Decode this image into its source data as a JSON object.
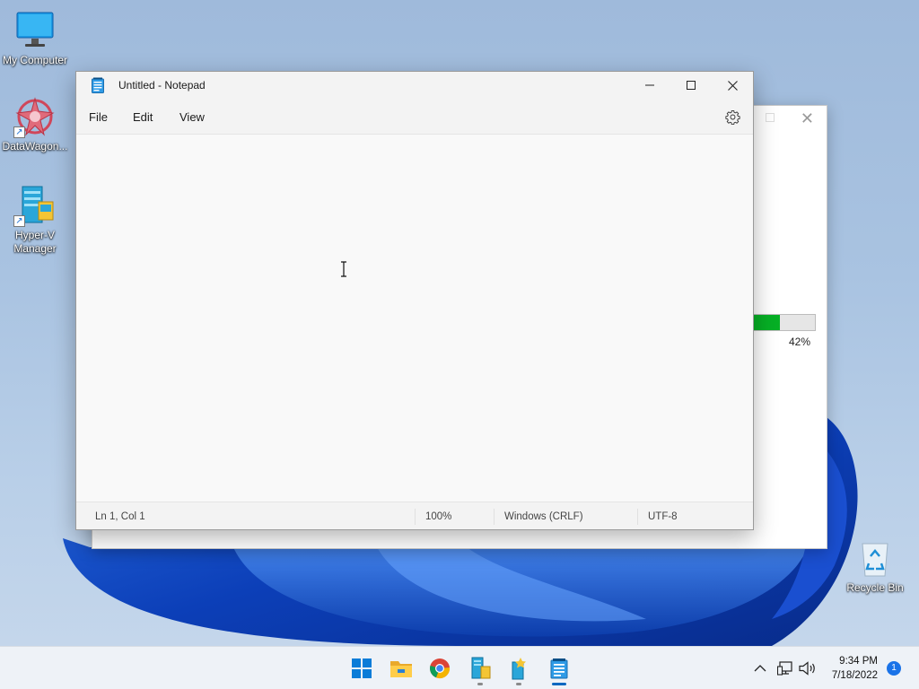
{
  "desktop": {
    "icons": [
      {
        "label": "My Computer",
        "icon": "monitor-icon"
      },
      {
        "label": "DataWagon...",
        "icon": "datawagon-icon"
      },
      {
        "label": "Hyper-V Manager",
        "icon": "hyperv-icon"
      },
      {
        "label": "Recycle Bin",
        "icon": "recycle-bin-icon"
      }
    ]
  },
  "background_window": {
    "progress_value": 0.42,
    "progress_label": "42%"
  },
  "notepad": {
    "title": "Untitled - Notepad",
    "menu": [
      "File",
      "Edit",
      "View"
    ],
    "settings_icon": "gear-icon",
    "editor_text": "",
    "status": {
      "position": "Ln 1, Col 1",
      "zoom": "100%",
      "line_ending": "Windows (CRLF)",
      "encoding": "UTF-8"
    }
  },
  "taskbar": {
    "apps": [
      {
        "name": "start",
        "icon": "windows-start-icon",
        "running": false
      },
      {
        "name": "file-explorer",
        "icon": "folder-icon",
        "running": false
      },
      {
        "name": "chrome",
        "icon": "chrome-icon",
        "running": false
      },
      {
        "name": "hyperv",
        "icon": "hyperv-icon",
        "running": true
      },
      {
        "name": "installer",
        "icon": "installer-icon",
        "running": true
      },
      {
        "name": "notepad",
        "icon": "notepad-icon",
        "running": true,
        "active": true
      }
    ],
    "clock": {
      "time": "9:34 PM",
      "date": "7/18/2022"
    },
    "notification_count": "1",
    "accent_color": "#0067c0"
  }
}
